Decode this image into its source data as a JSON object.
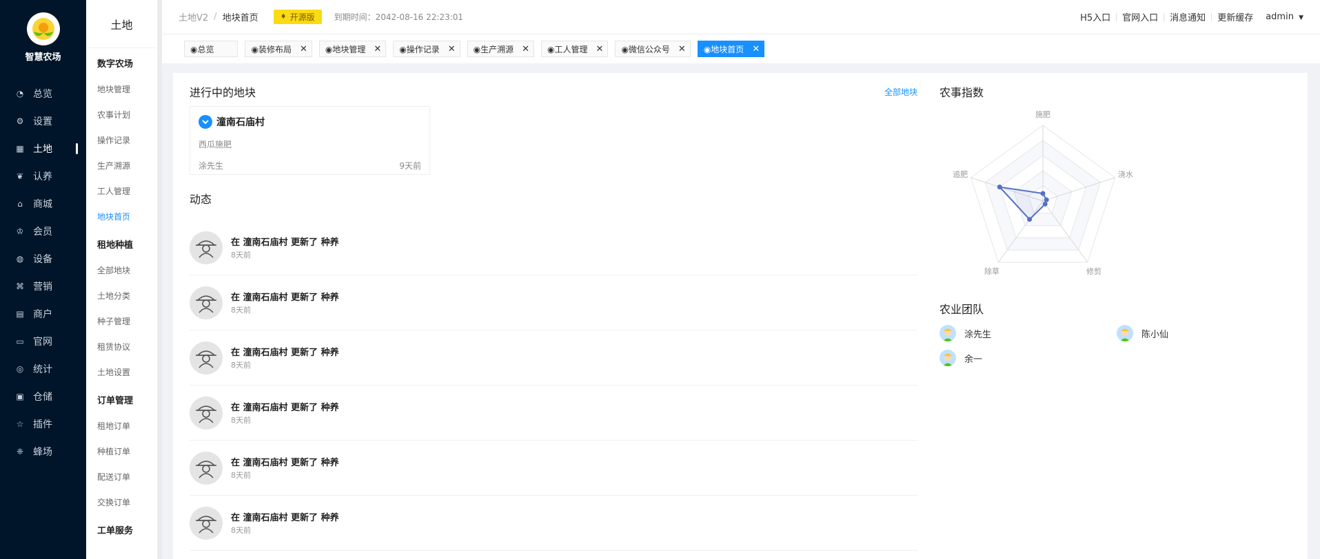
{
  "brand": {
    "name": "智慧农场"
  },
  "nav": [
    {
      "label": "总览",
      "icon": "dashboard-icon"
    },
    {
      "label": "设置",
      "icon": "gear-icon"
    },
    {
      "label": "土地",
      "icon": "grid-icon",
      "active": true
    },
    {
      "label": "认养",
      "icon": "paw-icon"
    },
    {
      "label": "商城",
      "icon": "shop-icon"
    },
    {
      "label": "会员",
      "icon": "member-icon"
    },
    {
      "label": "设备",
      "icon": "device-icon"
    },
    {
      "label": "营销",
      "icon": "marketing-icon"
    },
    {
      "label": "商户",
      "icon": "merchant-icon"
    },
    {
      "label": "官网",
      "icon": "website-icon"
    },
    {
      "label": "统计",
      "icon": "stats-icon"
    },
    {
      "label": "仓储",
      "icon": "storage-icon"
    },
    {
      "label": "插件",
      "icon": "star-icon"
    },
    {
      "label": "蜂场",
      "icon": "bee-icon"
    }
  ],
  "subnav": {
    "title": "土地",
    "groups": [
      {
        "title": "数字农场",
        "items": [
          "地块管理",
          "农事计划",
          "操作记录",
          "生产溯源",
          "工人管理",
          "地块首页"
        ]
      },
      {
        "title": "租地种植",
        "items": [
          "全部地块",
          "土地分类",
          "种子管理",
          "租赁协议",
          "土地设置"
        ]
      },
      {
        "title": "订单管理",
        "items": [
          "租地订单",
          "种植订单",
          "配送订单",
          "交换订单"
        ]
      },
      {
        "title": "工单服务",
        "items": []
      }
    ],
    "active_item": "地块首页"
  },
  "header": {
    "crumb_root": "土地V2",
    "crumb_current": "地块首页",
    "badge": "开源版",
    "expire": "到期时间：2042-08-16 22:23:01",
    "links": [
      "H5入口",
      "官网入口",
      "消息通知",
      "更新缓存"
    ],
    "user": "admin"
  },
  "tabs": [
    {
      "label": "◉总览",
      "closable": false
    },
    {
      "label": "◉装修布局",
      "closable": true
    },
    {
      "label": "◉地块管理",
      "closable": true
    },
    {
      "label": "◉操作记录",
      "closable": true
    },
    {
      "label": "◉生产溯源",
      "closable": true
    },
    {
      "label": "◉工人管理",
      "closable": true
    },
    {
      "label": "◉微信公众号",
      "closable": true
    },
    {
      "label": "◉地块首页",
      "closable": true,
      "active": true
    }
  ],
  "main": {
    "active_title": "进行中的地块",
    "all_link": "全部地块",
    "plot": {
      "name": "潼南石庙村",
      "task": "西瓜施肥",
      "owner": "涂先生",
      "time": "9天前"
    },
    "dynamics_title": "动态",
    "feed": [
      {
        "text": "在 潼南石庙村 更新了 种养",
        "time": "8天前"
      },
      {
        "text": "在 潼南石庙村 更新了 种养",
        "time": "8天前"
      },
      {
        "text": "在 潼南石庙村 更新了 种养",
        "time": "8天前"
      },
      {
        "text": "在 潼南石庙村 更新了 种养",
        "time": "8天前"
      },
      {
        "text": "在 潼南石庙村 更新了 种养",
        "time": "8天前"
      },
      {
        "text": "在 潼南石庙村 更新了 种养",
        "time": "8天前"
      }
    ],
    "index_title": "农事指数",
    "team_title": "农业团队",
    "team": [
      "涂先生",
      "陈小仙",
      "余一"
    ]
  },
  "chart_data": {
    "type": "radar",
    "indicators": [
      "施肥",
      "浇水",
      "修剪",
      "除草",
      "追肥"
    ],
    "values": [
      0.1,
      0.05,
      0.05,
      0.3,
      0.6
    ],
    "max": 1
  },
  "colors": {
    "accent": "#1890ff",
    "sidebar": "#001529",
    "radar_line": "#5470c6",
    "badge": "#fadb14"
  }
}
